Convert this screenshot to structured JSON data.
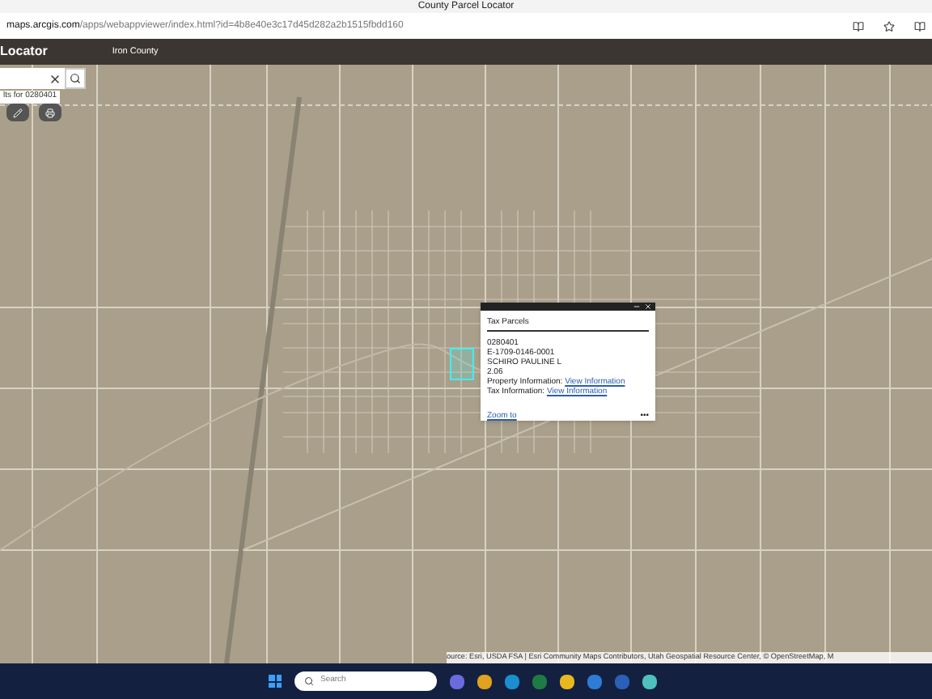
{
  "browser": {
    "tab_title": "County Parcel Locator",
    "url_host": "maps.arcgis.com",
    "url_path": "/apps/webappviewer/index.html?id=4b8e40e3c17d45d282a2b1515fbdd160"
  },
  "app": {
    "title": "Locator",
    "subtitle": "Iron County"
  },
  "search": {
    "results_hint": "lts for 0280401"
  },
  "popup": {
    "title": "Tax Parcels",
    "lines": [
      "0280401",
      "E-1709-0146-0001",
      "SCHIRO PAULINE L",
      "2.06"
    ],
    "links": [
      {
        "label": "Property Information:",
        "link": "View Information"
      },
      {
        "label": "Tax Information:",
        "link": "View Information"
      }
    ],
    "zoom_link": "Zoom to",
    "more": "•••"
  },
  "attribution": "ource: Esri, USDA FSA | Esri Community Maps Contributors, Utah Geospatial Resource Center, © OpenStreetMap, M",
  "taskbar": {
    "search_placeholder": "Search"
  }
}
